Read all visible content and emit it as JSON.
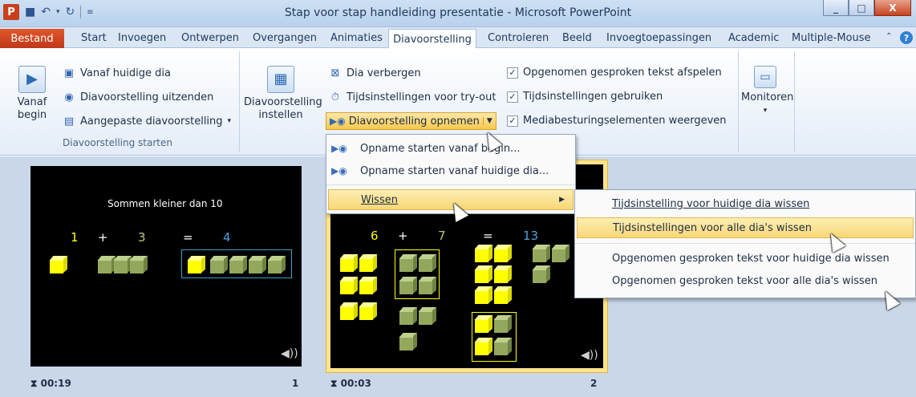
{
  "window": {
    "title": "Stap voor stap handleiding presentatie - Microsoft PowerPoint",
    "app_icon": "P"
  },
  "tabs": {
    "file": "Bestand",
    "items": [
      "Start",
      "Invoegen",
      "Ontwerpen",
      "Overgangen",
      "Animaties"
    ],
    "active": "Diavoorstelling",
    "rest": [
      "Controleren",
      "Beeld",
      "Invoegtoepassingen",
      "Academic",
      "Multiple-Mouse"
    ]
  },
  "ribbon": {
    "start_group": {
      "vanaf_begin": "Vanaf\nbegin",
      "vanaf_begin_l1": "Vanaf",
      "vanaf_begin_l2": "begin",
      "vanaf_huidige": "Vanaf huidige dia",
      "uitzenden": "Diavoorstelling uitzenden",
      "aangepaste": "Aangepaste diavoorstelling",
      "label": "Diavoorstelling starten"
    },
    "setup_group": {
      "instellen_l1": "Diavoorstelling",
      "instellen_l2": "instellen",
      "verbergen": "Dia verbergen",
      "tryout": "Tijdsinstellingen voor try-out",
      "opnemen": "Diavoorstelling opnemen"
    },
    "checks": {
      "afspelen": "Opgenomen gesproken tekst afspelen",
      "gebruiken": "Tijdsinstellingen gebruiken",
      "mediabesturing": "Mediabesturingselementen weergeven"
    },
    "monitors": {
      "label": "Monitoren"
    }
  },
  "dropdown": {
    "item1": "Opname starten vanaf begin...",
    "item2": "Opname starten vanaf huidige dia...",
    "item3": "Wissen"
  },
  "submenu": {
    "item1": "Tijdsinstelling voor huidige dia wissen",
    "item2": "Tijdsinstellingen voor alle dia's wissen",
    "item3": "Opgenomen gesproken tekst voor huidige dia wissen",
    "item4": "Opgenomen gesproken tekst voor alle dia's wissen"
  },
  "slides": [
    {
      "title": "Sommen kleiner dan 10",
      "a": "1",
      "op": "+",
      "b": "3",
      "eq": "=",
      "r": "4",
      "time": "00:19",
      "number": "1"
    },
    {
      "a": "6",
      "op": "+",
      "b": "7",
      "eq": "=",
      "r": "13",
      "time": "00:03",
      "number": "2"
    }
  ],
  "colors": {
    "accent_yellow": "#ffff00",
    "cube_green": "#93a85c",
    "result_blue": "#4aa3df",
    "highlight": "#f8d776"
  }
}
